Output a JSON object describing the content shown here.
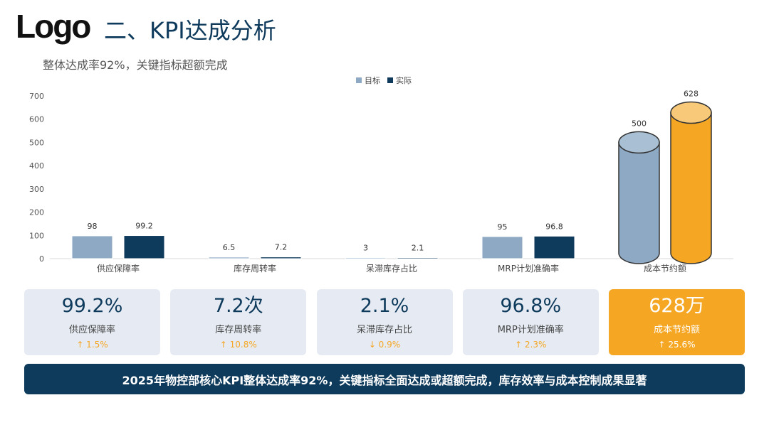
{
  "header": {
    "logo": "Logo",
    "title": "二、KPI达成分析",
    "subtitle": "整体达成率92%，关键指标超额完成"
  },
  "chart_data": {
    "type": "bar",
    "categories": [
      "供应保障率",
      "库存周转率",
      "呆滞库存占比",
      "MRP计划准确率",
      "成本节约额"
    ],
    "series": [
      {
        "name": "目标",
        "values": [
          98,
          6.5,
          3,
          95,
          500
        ]
      },
      {
        "name": "实际",
        "values": [
          99.2,
          7.2,
          2.1,
          96.8,
          628
        ]
      }
    ],
    "title": "",
    "xlabel": "",
    "ylabel": "",
    "ylim": [
      0,
      700
    ],
    "yticks": [
      0,
      100,
      200,
      300,
      400,
      500,
      600,
      700
    ],
    "legend": "top-center",
    "grid": false,
    "colors": {
      "target": "#8ea9c4",
      "actual": "#0e3a5c",
      "highlight_target": "#8ea9c4",
      "highlight_actual": "#f5a623"
    }
  },
  "kpis": [
    {
      "value": "99.2%",
      "label": "供应保障率",
      "change": "↑ 1.5%"
    },
    {
      "value": "7.2次",
      "label": "库存周转率",
      "change": "↑ 10.8%"
    },
    {
      "value": "2.1%",
      "label": "呆滞库存占比",
      "change": "↓ 0.9%"
    },
    {
      "value": "96.8%",
      "label": "MRP计划准确率",
      "change": "↑ 2.3%"
    },
    {
      "value": "628万",
      "label": "成本节约额",
      "change": "↑ 25.6%"
    }
  ],
  "banner": "2025年物控部核心KPI整体达成率92%，关键指标全面达成或超额完成，库存效率与成本控制成果显著"
}
